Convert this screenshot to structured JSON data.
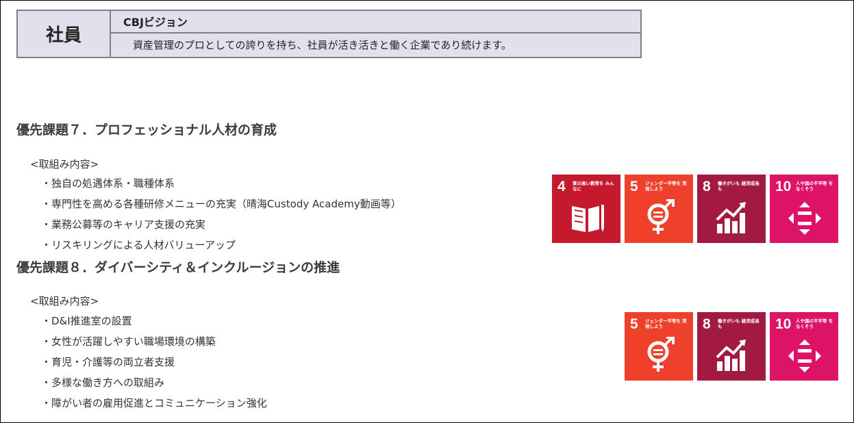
{
  "vision": {
    "left_label": "社員",
    "title": "CBJビジョン",
    "text": "資産管理のプロとしての誇りを持ち、社員が活き活きと働く企業であり続けます。"
  },
  "section7": {
    "heading": "優先課題７．プロフェッショナル人材の育成",
    "sub": "<取組み内容>",
    "items": [
      "・独自の処遇体系・職種体系",
      "・専門性を高める各種研修メニューの充実（晴海Custody Academy動画等）",
      "・業務公募等のキャリア支援の充実",
      "・リスキリングによる人材バリューアップ"
    ]
  },
  "section8": {
    "heading": "優先課題８．ダイバーシティ＆インクルージョンの推進",
    "sub": "<取組み内容>",
    "items": [
      "・D&I推進室の設置",
      "・女性が活躍しやすい職場環境の構築",
      "・育児・介護等の両立者支援",
      "・多様な働き方への取組み",
      "・障がい者の雇用促進とコミュニケーション強化"
    ]
  },
  "sdg": {
    "g4": {
      "num": "4",
      "cap": "質の高い教育を みんなに",
      "color": "#c5192d",
      "icon": "book-icon"
    },
    "g5": {
      "num": "5",
      "cap": "ジェンダー平等を 実現しよう",
      "color": "#ef402b",
      "icon": "gender-equality-icon"
    },
    "g8": {
      "num": "8",
      "cap": "働きがいも 経済成長も",
      "color": "#a21942",
      "icon": "growth-chart-icon"
    },
    "g10": {
      "num": "10",
      "cap": "人や国の不平等 をなくそう",
      "color": "#dd1367",
      "icon": "equality-arrows-icon"
    }
  }
}
